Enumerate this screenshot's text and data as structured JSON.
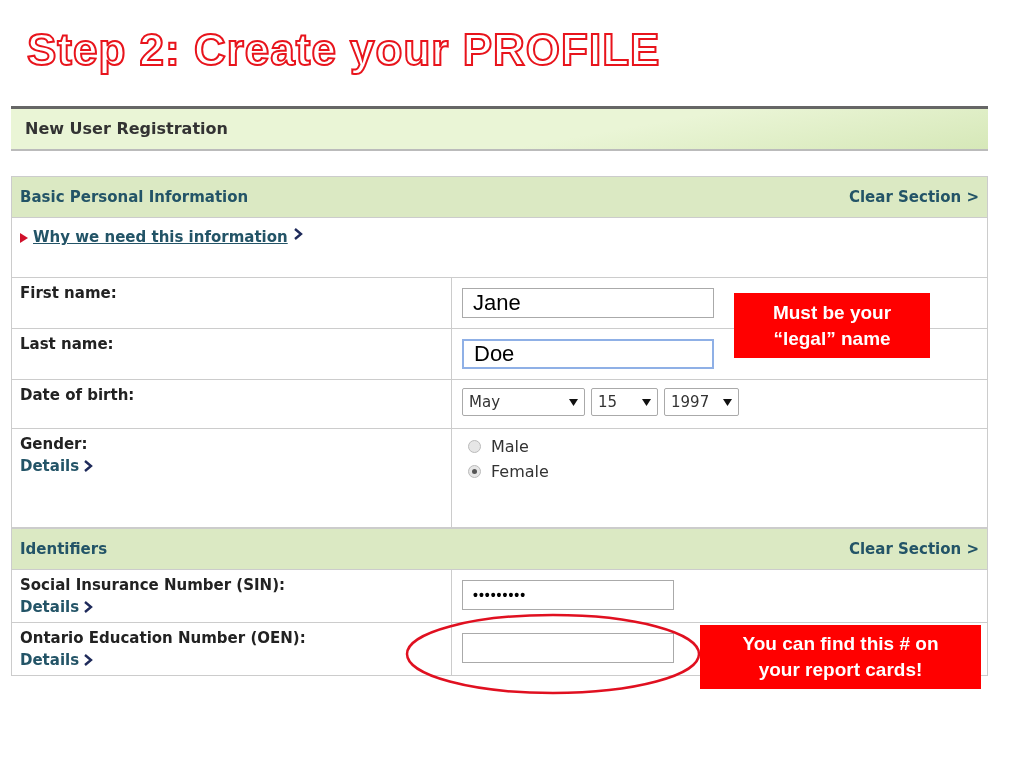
{
  "slide_title": "Step 2: Create your PROFILE",
  "page_header": "New User Registration",
  "sections": [
    {
      "title": "Basic Personal Information",
      "action": "Clear Section >",
      "info_link": "Why we need this information",
      "rows": [
        {
          "kind": "text",
          "label": "First name:",
          "value": "Jane",
          "focused": false
        },
        {
          "kind": "text",
          "label": "Last name:",
          "value": "Doe",
          "focused": true
        },
        {
          "kind": "date",
          "label": "Date of birth:",
          "selects": [
            "May",
            "15",
            "1997"
          ]
        },
        {
          "kind": "radio",
          "label": "Gender:",
          "link": "Details",
          "options": [
            {
              "label": "Male",
              "selected": false
            },
            {
              "label": "Female",
              "selected": true
            }
          ]
        }
      ]
    },
    {
      "title": "Identifiers",
      "action": "Clear Section >",
      "rows": [
        {
          "kind": "password",
          "label": "Social Insurance Number (SIN):",
          "link": "Details",
          "value": "•••••••••",
          "focused": false
        },
        {
          "kind": "text",
          "label": "Ontario Education Number (OEN):",
          "link": "Details",
          "focused": false,
          "circled": true
        }
      ]
    }
  ],
  "callouts": [
    {
      "text": "Must be your “legal” name"
    },
    {
      "text": "You can find this # on your report cards!"
    }
  ]
}
